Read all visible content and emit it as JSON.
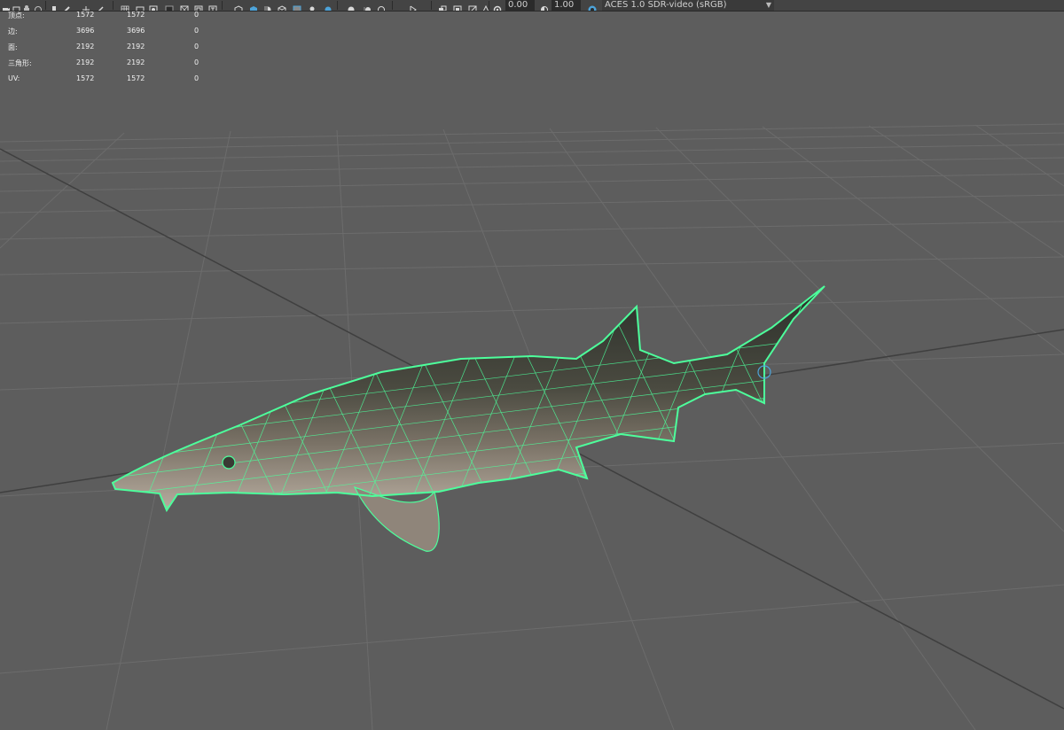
{
  "toolbar": {
    "field_1": "0.00",
    "field_2": "1.00",
    "color_space": "ACES 1.0 SDR-video (sRGB)",
    "icons": [
      "camera-icon",
      "camera-select-icon",
      "bookmark-icon",
      "pen-icon",
      "move-icon",
      "isolate-icon",
      "grid-icon",
      "film-gate-icon",
      "resolution-gate-icon",
      "gate-mask-icon",
      "field-chart-icon",
      "safe-action-icon",
      "safe-title-icon",
      "wireframe-icon",
      "smooth-shade-icon",
      "default-material-icon",
      "textured-icon",
      "xray-icon",
      "lighting-icon",
      "shadows-icon",
      "ambient-occlusion-icon",
      "motion-blur-icon",
      "multisample-icon",
      "isolate-select-icon",
      "xray-active-icon",
      "xray-joints-icon",
      "exposure-icon",
      "gamma-icon",
      "color-management-icon"
    ],
    "colors": {
      "bg": "#444444",
      "accent_blue": "#4da3d9"
    }
  },
  "hud": {
    "rows": [
      {
        "label": "顶点:",
        "v1": "1572",
        "v2": "1572",
        "v3": "0"
      },
      {
        "label": "边:",
        "v1": "3696",
        "v2": "3696",
        "v3": "0"
      },
      {
        "label": "面:",
        "v1": "2192",
        "v2": "2192",
        "v3": "0"
      },
      {
        "label": "三角形:",
        "v1": "2192",
        "v2": "2192",
        "v3": "0"
      },
      {
        "label": "UV:",
        "v1": "1572",
        "v2": "1572",
        "v3": "0"
      }
    ]
  },
  "viewport": {
    "background": "#5d5d5d",
    "grid_color": "#6c6c6c",
    "axis_color": "#3a3a3a",
    "wireframe_color": "#4dff9c",
    "object": "sturgeon-mesh"
  }
}
